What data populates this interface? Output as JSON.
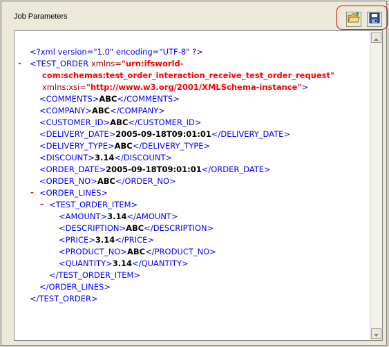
{
  "panel": {
    "title": "Job Parameters"
  },
  "toolbar": {
    "open_icon": "open-folder-icon",
    "save_icon": "floppy-disk-save-icon",
    "highlight_color": "#e00000"
  },
  "xml": {
    "declaration": "<?xml version=\"1.0\" encoding=\"UTF-8\" ?>",
    "collapse_marker": "-",
    "root_open_start": "<TEST_ORDER",
    "root_xmlns_name": "xmlns=",
    "root_xmlns_value_1": "\"urn:ifsworld-",
    "root_xmlns_value_2": "com:schemas:test_order_interaction_receive_test_order_request\"",
    "root_xsi_name": "xmlns:xsi=",
    "root_xsi_value": "\"http://www.w3.org/2001/XMLSchema-instance\"",
    "root_open_end": ">",
    "fields": [
      {
        "open": "<COMMENTS>",
        "value": "ABC",
        "close": "</COMMENTS>"
      },
      {
        "open": "<COMPANY>",
        "value": "ABC",
        "close": "</COMPANY>"
      },
      {
        "open": "<CUSTOMER_ID>",
        "value": "ABC",
        "close": "</CUSTOMER_ID>"
      },
      {
        "open": "<DELIVERY_DATE>",
        "value": "2005-09-18T09:01:01",
        "close": "</DELIVERY_DATE>"
      },
      {
        "open": "<DELIVERY_TYPE>",
        "value": "ABC",
        "close": "</DELIVERY_TYPE>"
      },
      {
        "open": "<DISCOUNT>",
        "value": "3.14",
        "close": "</DISCOUNT>"
      },
      {
        "open": "<ORDER_DATE>",
        "value": "2005-09-18T09:01:01",
        "close": "</ORDER_DATE>"
      },
      {
        "open": "<ORDER_NO>",
        "value": "ABC",
        "close": "</ORDER_NO>"
      }
    ],
    "order_lines_open": "<ORDER_LINES>",
    "item_open": "<TEST_ORDER_ITEM>",
    "item_fields": [
      {
        "open": "<AMOUNT>",
        "value": "3.14",
        "close": "</AMOUNT>"
      },
      {
        "open": "<DESCRIPTION>",
        "value": "ABC",
        "close": "</DESCRIPTION>"
      },
      {
        "open": "<PRICE>",
        "value": "3.14",
        "close": "</PRICE>"
      },
      {
        "open": "<PRODUCT_NO>",
        "value": "ABC",
        "close": "</PRODUCT_NO>"
      },
      {
        "open": "<QUANTITY>",
        "value": "3.14",
        "close": "</QUANTITY>"
      }
    ],
    "item_close": "</TEST_ORDER_ITEM>",
    "order_lines_close": "</ORDER_LINES>",
    "root_close": "</TEST_ORDER>"
  }
}
